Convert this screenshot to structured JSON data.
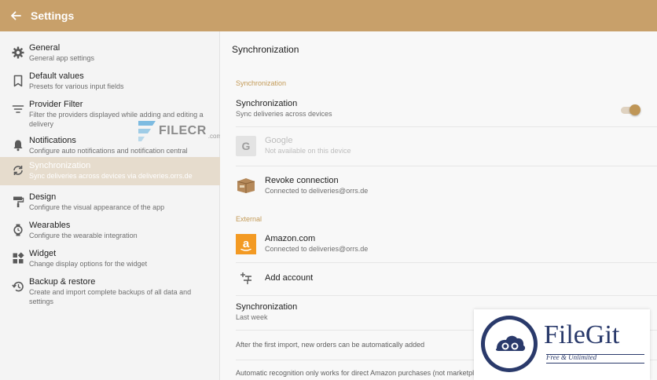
{
  "appbar": {
    "title": "Settings"
  },
  "sidebar": {
    "items": [
      {
        "label": "General",
        "desc": "General app settings",
        "icon": "gear-icon"
      },
      {
        "label": "Default values",
        "desc": "Presets for various input fields",
        "icon": "bookmark-icon"
      },
      {
        "label": "Provider Filter",
        "desc": "Filter the providers displayed while adding and editing a delivery",
        "icon": "filter-icon"
      },
      {
        "label": "Notifications",
        "desc": "Configure auto notifications and notification central",
        "icon": "bell-icon"
      },
      {
        "label": "Synchronization",
        "desc": "Sync deliveries across devices via deliveries.orrs.de",
        "icon": "sync-icon"
      },
      {
        "label": "Design",
        "desc": "Configure the visual appearance of the app",
        "icon": "paint-roller-icon"
      },
      {
        "label": "Wearables",
        "desc": "Configure the wearable integration",
        "icon": "watch-icon"
      },
      {
        "label": "Widget",
        "desc": "Change display options for the widget",
        "icon": "widget-icon"
      },
      {
        "label": "Backup & restore",
        "desc": "Create and import complete backups of all data and settings",
        "icon": "restore-icon"
      }
    ],
    "active_index": 4
  },
  "content": {
    "title": "Synchronization",
    "section_sync": "Synchronization",
    "sync_toggle": {
      "title": "Synchronization",
      "desc": "Sync deliveries across devices",
      "enabled": true
    },
    "google": {
      "title": "Google",
      "desc": "Not available on this device"
    },
    "revoke": {
      "title": "Revoke connection",
      "desc": "Connected to deliveries@orrs.de"
    },
    "section_external": "External",
    "amazon": {
      "title": "Amazon.com",
      "desc": "Connected to deliveries@orrs.de"
    },
    "add_account": "Add account",
    "sync_freq": {
      "title": "Synchronization",
      "desc": "Last week"
    },
    "note1": "After the first import, new orders can be automatically added",
    "note2": "Automatic recognition only works for direct Amazon purchases (not marketplace) via DHL, UPS, USPS etc."
  },
  "watermarks": {
    "filecr": {
      "name": "FILECR",
      "domain": ".com"
    },
    "filegit": {
      "name": "FileGit",
      "tagline": "Free & Unlimited"
    }
  },
  "colors": {
    "appbar": "#c8a06a",
    "accent": "#c39a57",
    "active_item": "#e6dccd",
    "amazon_orange": "#f39a23"
  }
}
